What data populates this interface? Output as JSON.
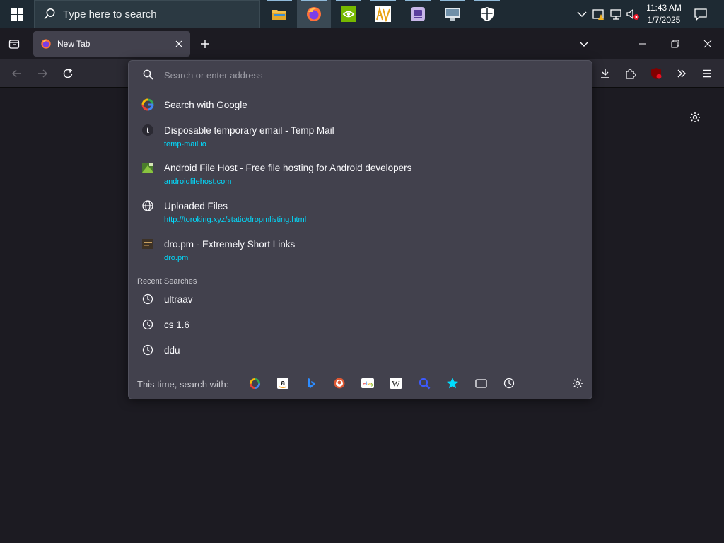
{
  "taskbar": {
    "search_placeholder": "Type here to search",
    "clock_time": "11:43 AM",
    "clock_date": "1/7/2025",
    "apps": [
      "file-explorer",
      "firefox",
      "nvidia",
      "av-app",
      "app-purple",
      "monitor-app",
      "shield-app"
    ]
  },
  "browser": {
    "tab_title": "New Tab"
  },
  "urlbar": {
    "placeholder": "Search or enter address",
    "value": "",
    "search_with_label": "Search with Google",
    "results": [
      {
        "title": "Disposable temporary email - Temp Mail",
        "url": "temp-mail.io",
        "icon": "temp-mail-icon"
      },
      {
        "title": "Android File Host - Free file hosting for Android developers",
        "url": "androidfilehost.com",
        "icon": "android-file-host-icon"
      },
      {
        "title": "Uploaded Files",
        "url": "http://toroking.xyz/static/dropmlisting.html",
        "icon": "globe-icon"
      },
      {
        "title": "dro.pm - Extremely Short Links",
        "url": "dro.pm",
        "icon": "dro-pm-icon"
      }
    ],
    "recent_searches_label": "Recent Searches",
    "recent_searches": [
      "ultraav",
      "cs 1.6",
      "ddu"
    ],
    "one_off_label": "This time, search with:",
    "one_off_engines": [
      "google",
      "amazon",
      "bing",
      "duckduckgo",
      "ebay",
      "wikipedia",
      "search-bookmarks",
      "bookmarks",
      "tabs",
      "history"
    ]
  },
  "colors": {
    "accent_link": "#00ddff",
    "panel": "#42414d",
    "toolbar": "#2b2a33",
    "background": "#1c1b22"
  }
}
